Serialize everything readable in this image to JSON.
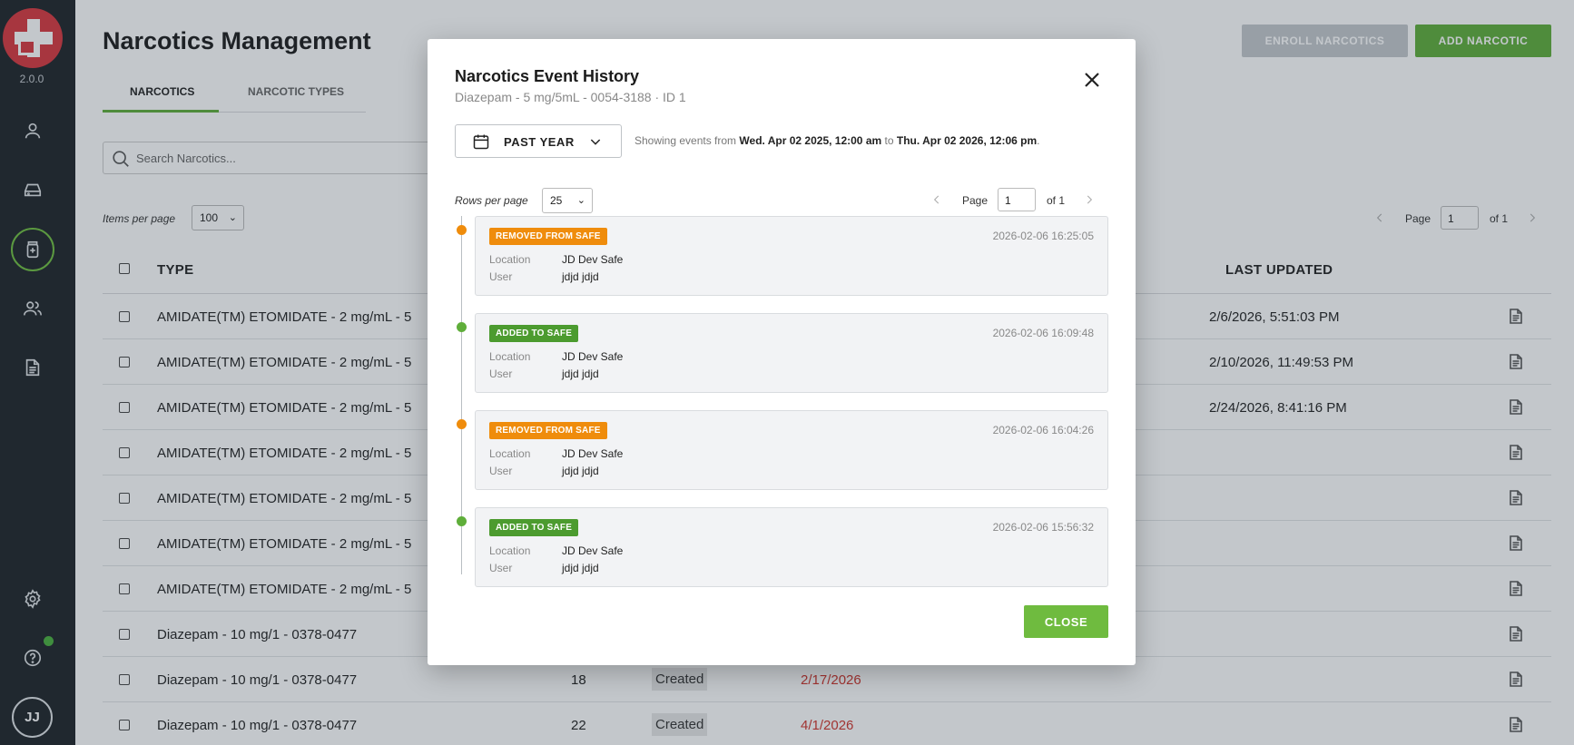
{
  "app": {
    "version": "2.0.0",
    "user_initials": "JJ"
  },
  "sidebar": {
    "items": [
      {
        "icon": "user-icon"
      },
      {
        "icon": "inbox-icon"
      },
      {
        "icon": "medication-icon",
        "active": true
      },
      {
        "icon": "users-icon"
      },
      {
        "icon": "document-icon"
      }
    ],
    "bottom": [
      {
        "icon": "gear-icon"
      },
      {
        "icon": "help-icon"
      }
    ]
  },
  "page": {
    "title": "Narcotics Management",
    "enroll_label": "ENROLL NARCOTICS",
    "add_label": "ADD NARCOTIC",
    "tabs": [
      "NARCOTICS",
      "NARCOTIC TYPES"
    ],
    "search_placeholder": "Search Narcotics...",
    "items_per_page_label": "Items per page",
    "items_per_page_value": "100",
    "pager": {
      "page_label": "Page",
      "page_value": "1",
      "of_label": "of 1"
    },
    "columns": {
      "type": "TYPE",
      "last_updated": "LAST UPDATED"
    },
    "rows": [
      {
        "type": "AMIDATE(TM) ETOMIDATE - 2 mg/mL - 5",
        "qty": "",
        "status": "",
        "exp": "",
        "updated": "2/6/2026, 5:51:03 PM"
      },
      {
        "type": "AMIDATE(TM) ETOMIDATE - 2 mg/mL - 5",
        "qty": "",
        "status": "",
        "exp": "",
        "updated": "2/10/2026, 11:49:53 PM"
      },
      {
        "type": "AMIDATE(TM) ETOMIDATE - 2 mg/mL - 5",
        "qty": "",
        "status": "",
        "exp": "",
        "updated": "2/24/2026, 8:41:16 PM"
      },
      {
        "type": "AMIDATE(TM) ETOMIDATE - 2 mg/mL - 5",
        "qty": "",
        "status": "",
        "exp": "",
        "updated": ""
      },
      {
        "type": "AMIDATE(TM) ETOMIDATE - 2 mg/mL - 5",
        "qty": "",
        "status": "",
        "exp": "",
        "updated": ""
      },
      {
        "type": "AMIDATE(TM) ETOMIDATE - 2 mg/mL - 5",
        "qty": "",
        "status": "",
        "exp": "",
        "updated": ""
      },
      {
        "type": "AMIDATE(TM) ETOMIDATE - 2 mg/mL - 5",
        "qty": "",
        "status": "",
        "exp": "",
        "updated": ""
      },
      {
        "type": "Diazepam - 10 mg/1 - 0378-0477",
        "qty": "",
        "status": "",
        "exp": "",
        "updated": ""
      },
      {
        "type": "Diazepam - 10 mg/1 - 0378-0477",
        "qty": "18",
        "status": "Created",
        "exp": "2/17/2026",
        "updated": ""
      },
      {
        "type": "Diazepam - 10 mg/1 - 0378-0477",
        "qty": "22",
        "status": "Created",
        "exp": "4/1/2026",
        "updated": ""
      }
    ]
  },
  "modal": {
    "title": "Narcotics Event History",
    "subtitle": "Diazepam - 5 mg/5mL - 0054-3188 · ID 1",
    "range_label": "PAST YEAR",
    "showing_prefix": "Showing events from",
    "showing_from": "Wed. Apr 02 2025, 12:00 am",
    "showing_to_word": "to",
    "showing_to": "Thu. Apr 02 2026, 12:06 pm",
    "showing_suffix": ".",
    "rows_per_page_label": "Rows per page",
    "rows_per_page_value": "25",
    "pager": {
      "page_label": "Page",
      "page_value": "1",
      "of_label": "of 1"
    },
    "location_label": "Location",
    "user_label": "User",
    "events": [
      {
        "badge": "REMOVED FROM SAFE",
        "kind": "orange",
        "time": "2026-02-06 16:25:05",
        "location": "JD Dev Safe",
        "user": "jdjd jdjd"
      },
      {
        "badge": "ADDED TO SAFE",
        "kind": "green",
        "time": "2026-02-06 16:09:48",
        "location": "JD Dev Safe",
        "user": "jdjd jdjd"
      },
      {
        "badge": "REMOVED FROM SAFE",
        "kind": "orange",
        "time": "2026-02-06 16:04:26",
        "location": "JD Dev Safe",
        "user": "jdjd jdjd"
      },
      {
        "badge": "ADDED TO SAFE",
        "kind": "green",
        "time": "2026-02-06 15:56:32",
        "location": "JD Dev Safe",
        "user": "jdjd jdjd"
      }
    ],
    "close_label": "CLOSE"
  },
  "colors": {
    "accent_green": "#5fae3a",
    "removed_orange": "#ef8c0c",
    "expired_red": "#d0342c",
    "sidebar_bg": "#1e2328"
  }
}
